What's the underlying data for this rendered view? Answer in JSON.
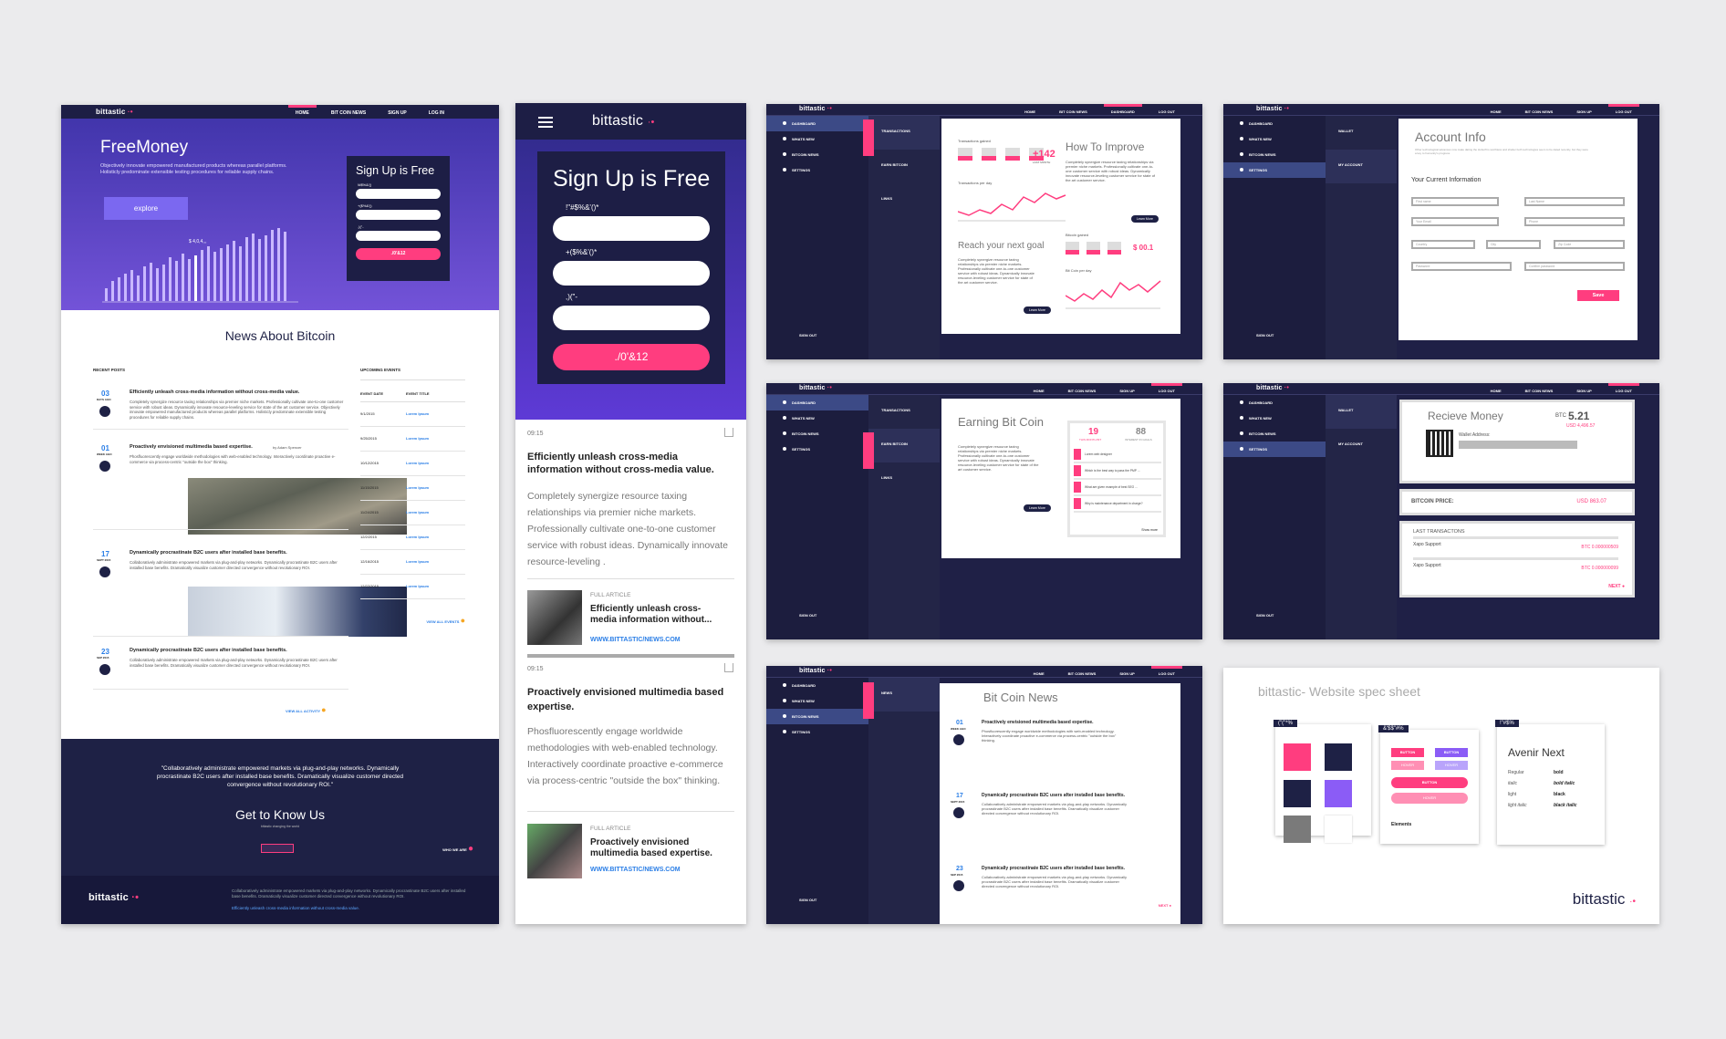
{
  "brand": {
    "name": "bittastic",
    "pink": "#ff3d7f",
    "navy": "#1e1f44",
    "purple": "#6b4de6"
  },
  "desktop": {
    "nav": [
      "HOME",
      "BIT COIN NEWS",
      "SIGN UP",
      "LOG IN"
    ],
    "hero": {
      "title": "FreeMoney",
      "text": "Objectively innovate empowered manufactured products whereas parallel platforms. Holisticly predominate extensible testing procedures for reliable supply chains.",
      "explore": "explore",
      "signup_title": "Sign Up is Free",
      "f1": "!#$%&'()",
      "f2": "+($%&'()",
      "f3": ",)(\"-",
      "submit": "./0'&12",
      "chart_label": "$ 4,0,4,,,"
    },
    "news_title": "News About Bitcoin",
    "recent_posts": "RECENT POSTS",
    "upcoming_events": "UPCOMING EVENTS",
    "event_date": "EVENT DATE",
    "event_title": "EVENT TITLE",
    "posts": [
      {
        "day": "03",
        "sub": "DAYS AGO",
        "title": "Efficiently unleash cross-media information without cross-media value.",
        "text": "Completely synergize resource taxing relationships via premier niche markets. Professionally cultivate one-to-one customer service with robust ideas. Dynamically innovate resource-leveling service for state of the art customer service. Objectively innovate empowered manufactured products whereas parallel platforms. Holisticly predominate extensible testing procedures for reliable supply chains."
      },
      {
        "day": "01",
        "sub": "WEEK AGO",
        "title": "Proactively envisioned multimedia based expertise.",
        "by": "by Adam Spencer",
        "text": "Phosfluorescently engage worldwide methodologies with web-enabled technology. Interactively coordinate proactive e-commerce via process-centric \"outside the box\" thinking."
      },
      {
        "day": "17",
        "sub": "SEPT 2015",
        "title": "Dynamically procrastinate B2C users after installed base benefits.",
        "text": "Collaboratively administrate empowered markets via plug-and-play networks. Dynamically procrastinate B2C users after installed base benefits. Dramatically visualize customer directed convergence without revolutionary ROI."
      },
      {
        "day": "23",
        "sub": "SEP 2015",
        "title": "Dynamically procrastinate B2C users after installed base benefits.",
        "text": "Collaboratively administrate empowered markets via plug-and-play networks. Dynamically procrastinate B2C users after installed base benefits. Dramatically visualize customer directed convergence without revolutionary ROI."
      }
    ],
    "events": [
      [
        "9/1/2015",
        "Lorem Ipsum"
      ],
      [
        "9/25/2015",
        "Lorem Ipsum"
      ],
      [
        "10/12/2015",
        "Lorem Ipsum"
      ],
      [
        "11/15/2015",
        "Lorem Ipsum"
      ],
      [
        "11/24/2015",
        "Lorem Ipsum"
      ],
      [
        "12/2/2015",
        "Lorem Ipsum"
      ],
      [
        "12/16/2015",
        "Lorem Ipsum"
      ],
      [
        "12/22/2015",
        "Lorem Ipsum"
      ]
    ],
    "view_all_events": "VIEW ALL EVENTS",
    "view_all_activity": "VIEW ALL ACTIVITY",
    "quote": "\"Collaboratively administrate empowered markets via plug-and-play networks. Dynamically procrastinate B2C users after installed base benefits. Dramatically visualize customer directed convergence without revolutionary ROI.\"",
    "know_title": "Get to Know Us",
    "know_sub": "bittastic changing the world",
    "who_we_are": "WHO WE ARE",
    "footer_text": "Collaboratively administrate empowered markets via plug-and-play networks. Dynamically procrastinate B2C users after installed base benefits. Dramatically visualize customer directed convergence without revolutionary ROI.",
    "footer_link": "Efficiently unleash cross-media information without cross-media value."
  },
  "mobile": {
    "signup_title": "Sign Up is Free",
    "f1": "!\"#$%&'()*",
    "f2": "+($%&'()*",
    "f3": ",)(\"-",
    "submit": "./0'&12",
    "time": "09:15",
    "a1_title": "Efficiently unleash cross-media information without cross-media value.",
    "a1_text": "Completely synergize resource taxing relationships via premier niche markets. Professionally cultivate one-to-one customer service with robust ideas. Dynamically innovate resource-leveling .",
    "full_article": "FULL ARTICLE",
    "r1_title": "Efficiently unleash cross-media information without...",
    "link": "WWW.BITTASTIC/NEWS.COM",
    "a2_title": "Proactively envisioned multimedia based expertise.",
    "a2_text": "Phosfluorescently engage worldwide methodologies with web-enabled technology. Interactively coordinate proactive e-commerce via process-centric \"outside the box\" thinking.",
    "r2_title": "Proactively envisioned multimedia based expertise."
  },
  "dash": {
    "nav1": [
      "HOME",
      "BIT COIN NEWS",
      "DASHBOARD",
      "LOG OUT"
    ],
    "nav2": [
      "HOME",
      "BIT COIN NEWS",
      "SIGN UP",
      "LOG OUT"
    ],
    "side": [
      "DASHBOARD",
      "WHATS NEW",
      "BITCOIN NEWS",
      "SETTINGS"
    ],
    "sub1": [
      "TRANSACTIONS",
      "EARN BITCOIN",
      "LINKS"
    ],
    "sub_acc": [
      "WALLET",
      "MY ACCOUNT"
    ],
    "signout": "SIGN OUT",
    "trans_gained": "Transactions gained",
    "plus": "+142",
    "last_month": "LAST MONTH",
    "trans_day": "Transactions per day",
    "how_improve": "How To Improve",
    "learn_more": "Learn More",
    "reach_goal": "Reach your next goal",
    "bitcoin_gained": "Bitcoin gained",
    "btc_gain": "$ 00.1",
    "btc_per_day": "Bit Coin per day",
    "body_text": "Completely synergize resource taxing relationships via premier niche markets. Professionally cultivate one-to-one customer service with robust ideas. Dynamically innovate resource-leveling customer service for state of the art customer service.",
    "account_info": "Account Info",
    "account_sub": "Other technological advances now make dating the Hoboth'rs worthless and shelter both technologies seem to be dated recently, but they were a key to humanity's progress.",
    "current_info": "Your Current Information",
    "fields": [
      "First name",
      "Last Name",
      "Your Email",
      "Phone",
      "Country",
      "City",
      "Zip Code",
      "Password",
      "Confirm password"
    ],
    "save": "Save",
    "earning": "Earning Bit Coin",
    "n19": "19",
    "n19l": "THIS MONTH BIT",
    "n88": "88",
    "n88l": "INTEREST IN GOALS",
    "q": [
      "Lorem web designer",
      "Which is the best way to pass the PMP ...",
      "What are given example of best SEO ...",
      "Why is maintenance department in charge?"
    ],
    "show_more": "Show more",
    "receive": "Recieve Money",
    "btc": "BTC",
    "btc_val": "5.21",
    "usd_val": "USD 4,496.57",
    "wallet_addr": "Wallet Address:",
    "btc_price": "BITCOIN PRICE:",
    "usd_price": "USD 863.07",
    "last_trans": "LAST TRANSACTONS",
    "trans": [
      [
        "Xapo Support",
        "BTC 0.000000509"
      ],
      [
        "Xapo Support",
        "BTC 0.000000099"
      ]
    ],
    "next": "NEXT",
    "bcn_title": "Bit Coin News",
    "news": "NEWS"
  },
  "spec": {
    "title": "bittastic- Website spec sheet",
    "colors_tag": "(\"(\"*%",
    "buttons_tag": "&'$$\"#%",
    "font_tag": "!\"#$%",
    "font": "Avenir Next",
    "weights": [
      [
        "Regular",
        "bold"
      ],
      [
        "italic",
        "bold italic"
      ],
      [
        "light",
        "black"
      ],
      [
        "light italic",
        "black italic"
      ]
    ],
    "button": "BUTTON",
    "hover": "HOVER",
    "elements": "Elements"
  }
}
